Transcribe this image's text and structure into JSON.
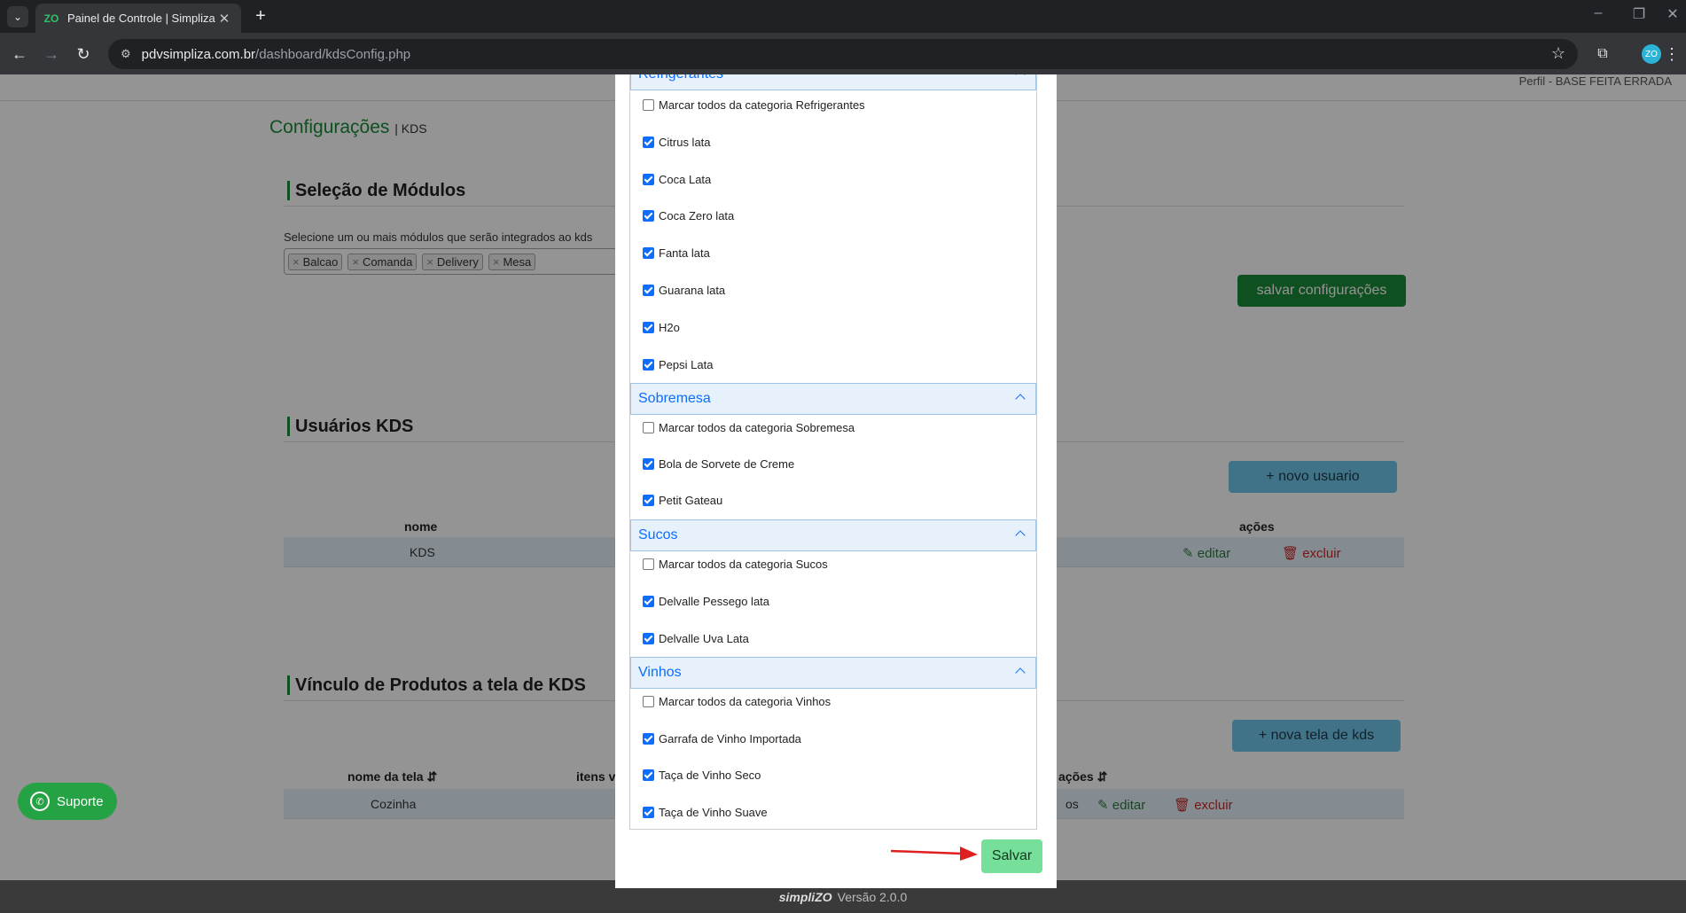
{
  "browser": {
    "tab_title": "Painel de Controle | Simpliza",
    "url_host": "pdvsimpliza.com.br",
    "url_path": "/dashboard/kdsConfig.php",
    "favicon_text": "ZO",
    "avatar_text": "ZO"
  },
  "page": {
    "profile": "Perfil - BASE FEITA ERRADA",
    "breadcrumb_title": "Configurações",
    "breadcrumb_sub": "| KDS",
    "modules": {
      "title": "Seleção de Módulos",
      "label": "Selecione um ou mais módulos que serão integrados ao kds",
      "chips": [
        "Balcao",
        "Comanda",
        "Delivery",
        "Mesa"
      ],
      "save_button": "salvar configurações"
    },
    "users": {
      "title": "Usuários KDS",
      "new_button": "+ novo usuario",
      "col_name": "nome",
      "col_actions": "ações",
      "row_name": "KDS",
      "edit": "editar",
      "delete": "excluir"
    },
    "links": {
      "title": "Vínculo de Produtos a tela de KDS",
      "new_button": "+ nova tela de kds",
      "col_screen": "nome da tela ⇵",
      "col_items": "itens v",
      "col_actions": "ações ⇵",
      "row_name": "Cozinha",
      "row_items_tail": "os",
      "edit": "editar",
      "delete": "excluir"
    },
    "footer": {
      "logo": "simpliZO",
      "version": "Versão 2.0.0"
    },
    "support": "Suporte"
  },
  "modal": {
    "categories": [
      {
        "name": "Refrigerantes",
        "select_all": "Marcar todos da categoria Refrigerantes",
        "items": [
          "Citrus lata",
          "Coca Lata",
          "Coca Zero lata",
          "Fanta lata",
          "Guarana lata",
          "H2o",
          "Pepsi Lata"
        ]
      },
      {
        "name": "Sobremesa",
        "select_all": "Marcar todos da categoria Sobremesa",
        "items": [
          "Bola de Sorvete de Creme",
          "Petit Gateau"
        ]
      },
      {
        "name": "Sucos",
        "select_all": "Marcar todos da categoria Sucos",
        "items": [
          "Delvalle Pessego lata",
          "Delvalle Uva Lata"
        ]
      },
      {
        "name": "Vinhos",
        "select_all": "Marcar todos da categoria Vinhos",
        "items": [
          "Garrafa de Vinho Importada",
          "Taça de Vinho Seco",
          "Taça de Vinho Suave"
        ]
      }
    ],
    "save_button": "Salvar"
  }
}
